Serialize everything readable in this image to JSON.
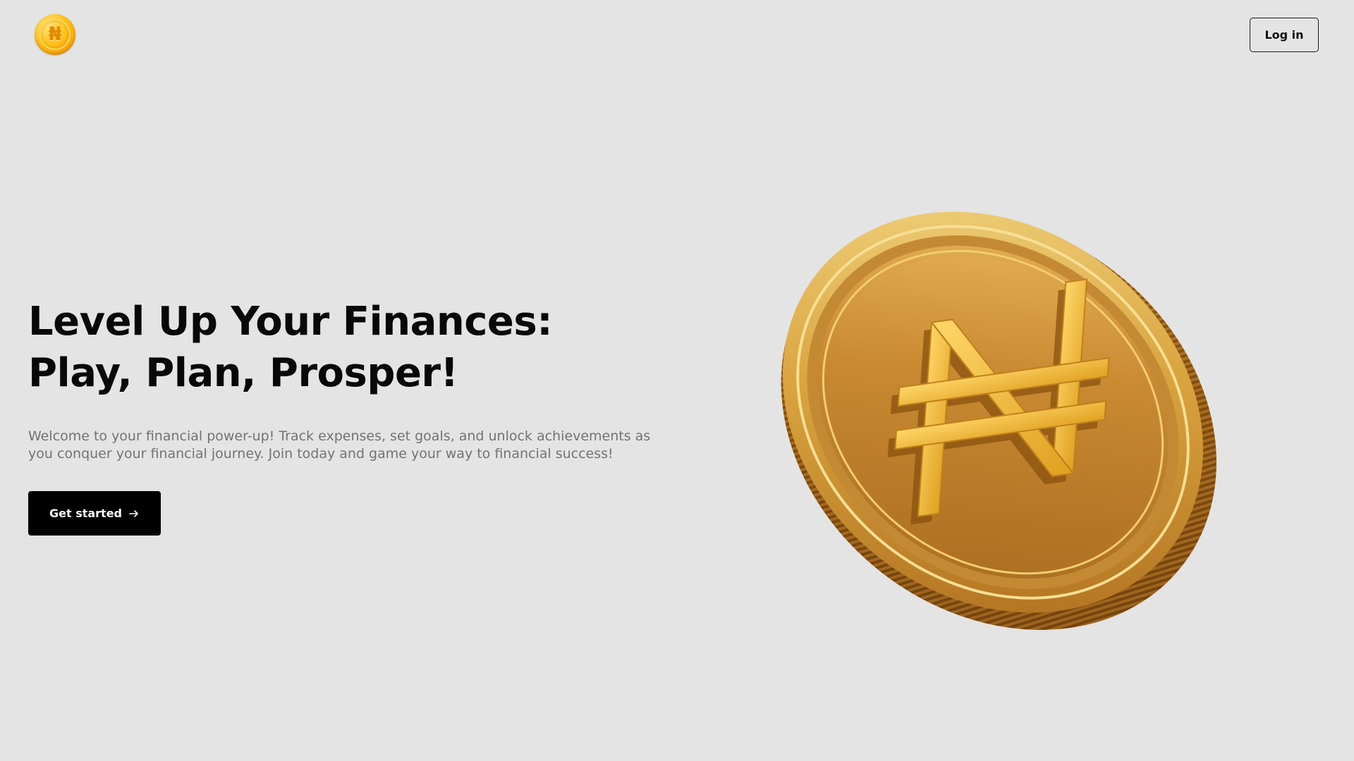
{
  "header": {
    "logo_glyph": "₦",
    "login_label": "Log in"
  },
  "hero": {
    "title": "Level Up Your Finances: Play, Plan, Prosper!",
    "subtitle": "Welcome to your financial power-up! Track expenses, set goals, and unlock achievements as you conquer your financial journey. Join today and game your way to financial success!",
    "cta_label": "Get started",
    "cta_icon": "arrow-right-icon"
  },
  "illustration": {
    "name": "gold-naira-coin",
    "symbol": "₦",
    "colors": {
      "gold_light": "#f3d27a",
      "gold_mid": "#d39a35",
      "gold_dark": "#8a520f"
    }
  },
  "theme": {
    "background": "#e4e4e4",
    "text": "#080808",
    "muted_text": "#727272",
    "button_bg": "#000000"
  }
}
